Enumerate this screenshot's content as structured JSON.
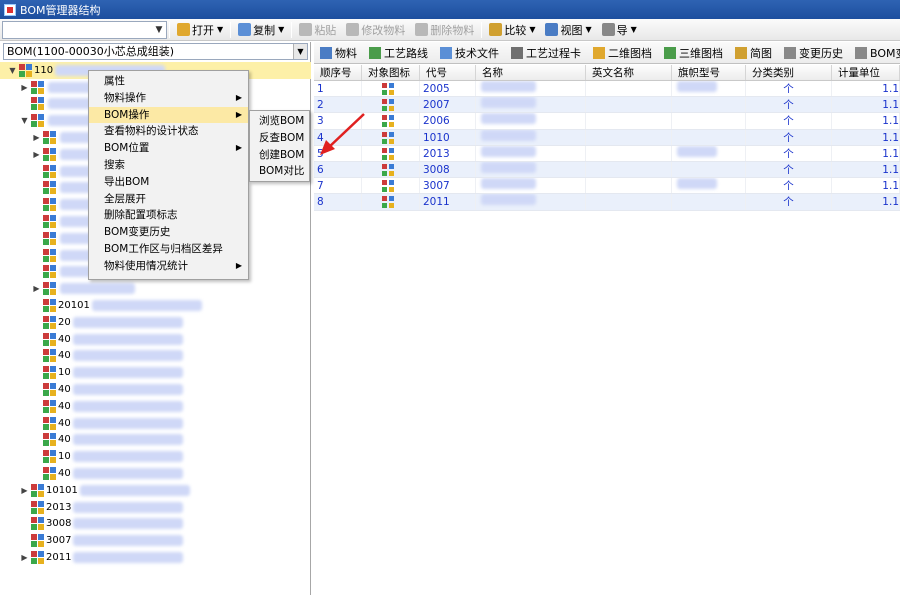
{
  "window": {
    "title": "BOM管理器结构"
  },
  "toolbar": {
    "items": [
      {
        "label": "打开",
        "dropdown": true,
        "disabled": false,
        "icon": "folder-icon",
        "color": "#e0a82e"
      },
      {
        "label": "复制",
        "dropdown": true,
        "disabled": false,
        "icon": "copy-icon",
        "color": "#5b8fd6"
      },
      {
        "label": "粘贴",
        "dropdown": false,
        "disabled": true,
        "icon": "paste-icon",
        "color": "#b8b8b8"
      },
      {
        "label": "修改物料",
        "dropdown": false,
        "disabled": true,
        "icon": "edit-icon",
        "color": "#b8b8b8"
      },
      {
        "label": "删除物料",
        "dropdown": false,
        "disabled": true,
        "icon": "delete-icon",
        "color": "#b8b8b8"
      },
      {
        "label": "比较",
        "dropdown": true,
        "disabled": false,
        "icon": "compare-icon",
        "color": "#d0a030"
      },
      {
        "label": "视图",
        "dropdown": true,
        "disabled": false,
        "icon": "view-icon",
        "color": "#4a7cc4"
      },
      {
        "label": "导",
        "dropdown": true,
        "disabled": false,
        "icon": "export-icon",
        "color": "#888888"
      }
    ]
  },
  "left": {
    "bom_selector": "BOM(1100-00030小芯总成组装)",
    "tree": [
      {
        "expander": "▼",
        "indent": 8,
        "code": "110",
        "selected": true
      },
      {
        "expander": "▶",
        "indent": 20,
        "code": "",
        "selected": false
      },
      {
        "expander": "",
        "indent": 20,
        "code": "",
        "selected": false
      },
      {
        "expander": "▼",
        "indent": 20,
        "code": "",
        "selected": false
      },
      {
        "expander": "▶",
        "indent": 32,
        "code": "",
        "selected": false
      },
      {
        "expander": "▶",
        "indent": 32,
        "code": "",
        "selected": false
      },
      {
        "expander": "",
        "indent": 32,
        "code": "",
        "selected": false
      },
      {
        "expander": "",
        "indent": 32,
        "code": "",
        "selected": false
      },
      {
        "expander": "",
        "indent": 32,
        "code": "",
        "selected": false
      },
      {
        "expander": "",
        "indent": 32,
        "code": "",
        "selected": false
      },
      {
        "expander": "",
        "indent": 32,
        "code": "",
        "selected": false
      },
      {
        "expander": "",
        "indent": 32,
        "code": "",
        "selected": false
      },
      {
        "expander": "",
        "indent": 32,
        "code": "",
        "selected": false
      },
      {
        "expander": "▶",
        "indent": 32,
        "code": "",
        "selected": false
      },
      {
        "expander": "",
        "indent": 32,
        "code": "20101",
        "selected": false
      },
      {
        "expander": "",
        "indent": 32,
        "code": "20",
        "selected": false
      },
      {
        "expander": "",
        "indent": 32,
        "code": "40",
        "selected": false
      },
      {
        "expander": "",
        "indent": 32,
        "code": "40",
        "selected": false
      },
      {
        "expander": "",
        "indent": 32,
        "code": "10",
        "selected": false
      },
      {
        "expander": "",
        "indent": 32,
        "code": "40",
        "selected": false
      },
      {
        "expander": "",
        "indent": 32,
        "code": "40",
        "selected": false
      },
      {
        "expander": "",
        "indent": 32,
        "code": "40",
        "selected": false
      },
      {
        "expander": "",
        "indent": 32,
        "code": "40",
        "selected": false
      },
      {
        "expander": "",
        "indent": 32,
        "code": "10",
        "selected": false
      },
      {
        "expander": "",
        "indent": 32,
        "code": "40",
        "selected": false
      },
      {
        "expander": "▶",
        "indent": 20,
        "code": "10101",
        "selected": false
      },
      {
        "expander": "",
        "indent": 20,
        "code": "2013",
        "selected": false
      },
      {
        "expander": "",
        "indent": 20,
        "code": "3008",
        "selected": false
      },
      {
        "expander": "",
        "indent": 20,
        "code": "3007",
        "selected": false
      },
      {
        "expander": "▶",
        "indent": 20,
        "code": "2011",
        "selected": false
      }
    ]
  },
  "context_menu": {
    "items": [
      {
        "label": "属性",
        "submenu": false,
        "active": false
      },
      {
        "label": "物料操作",
        "submenu": true,
        "active": false
      },
      {
        "label": "BOM操作",
        "submenu": true,
        "active": true
      },
      {
        "label": "查看物料的设计状态",
        "submenu": false,
        "active": false
      },
      {
        "label": "BOM位置",
        "submenu": true,
        "active": false
      },
      {
        "label": "搜索",
        "submenu": false,
        "active": false
      },
      {
        "label": "导出BOM",
        "submenu": false,
        "active": false
      },
      {
        "label": "全层展开",
        "submenu": false,
        "active": false
      },
      {
        "label": "删除配置项标志",
        "submenu": false,
        "active": false
      },
      {
        "label": "BOM变更历史",
        "submenu": false,
        "active": false
      },
      {
        "label": "BOM工作区与归档区差异",
        "submenu": false,
        "active": false
      },
      {
        "label": "物料使用情况统计",
        "submenu": true,
        "active": false
      }
    ],
    "submenu": [
      {
        "label": "浏览BOM"
      },
      {
        "label": "反查BOM"
      },
      {
        "label": "创建BOM"
      },
      {
        "label": "BOM对比"
      }
    ]
  },
  "right": {
    "tabs": [
      {
        "label": "物料",
        "icon": "material-icon",
        "color": "#4a7cc4"
      },
      {
        "label": "工艺路线",
        "icon": "route-icon",
        "color": "#4a9c4a"
      },
      {
        "label": "技术文件",
        "icon": "document-icon",
        "color": "#5b8fd6"
      },
      {
        "label": "工艺过程卡",
        "icon": "card-icon",
        "color": "#707070"
      },
      {
        "label": "二维图档",
        "icon": "drawing-icon",
        "color": "#e0a82e"
      },
      {
        "label": "三维图档",
        "icon": "model-icon",
        "color": "#4a9c4a"
      },
      {
        "label": "简图",
        "icon": "sketch-icon",
        "color": "#d0a030"
      },
      {
        "label": "变更历史",
        "icon": "history-icon",
        "color": "#888888"
      },
      {
        "label": "BOM变更历史",
        "icon": "bom-history-icon",
        "color": "#888888"
      }
    ],
    "grid": {
      "columns": [
        "顺序号",
        "对象图标",
        "代号",
        "名称",
        "英文名称",
        "旗帜型号",
        "分类类别",
        "计量单位"
      ],
      "rows": [
        {
          "seq": "1",
          "code": "2005",
          "unit": "个",
          "qty": "1.1"
        },
        {
          "seq": "2",
          "code": "2007",
          "unit": "个",
          "qty": "1.1"
        },
        {
          "seq": "3",
          "code": "2006",
          "unit": "个",
          "qty": "1.1"
        },
        {
          "seq": "4",
          "code": "1010",
          "unit": "个",
          "qty": "1.1"
        },
        {
          "seq": "5",
          "code": "2013",
          "unit": "个",
          "qty": "1.1"
        },
        {
          "seq": "6",
          "code": "3008",
          "unit": "个",
          "qty": "1.1"
        },
        {
          "seq": "7",
          "code": "3007",
          "unit": "个",
          "qty": "1.1"
        },
        {
          "seq": "8",
          "code": "2011",
          "unit": "个",
          "qty": "1.1"
        }
      ]
    }
  }
}
